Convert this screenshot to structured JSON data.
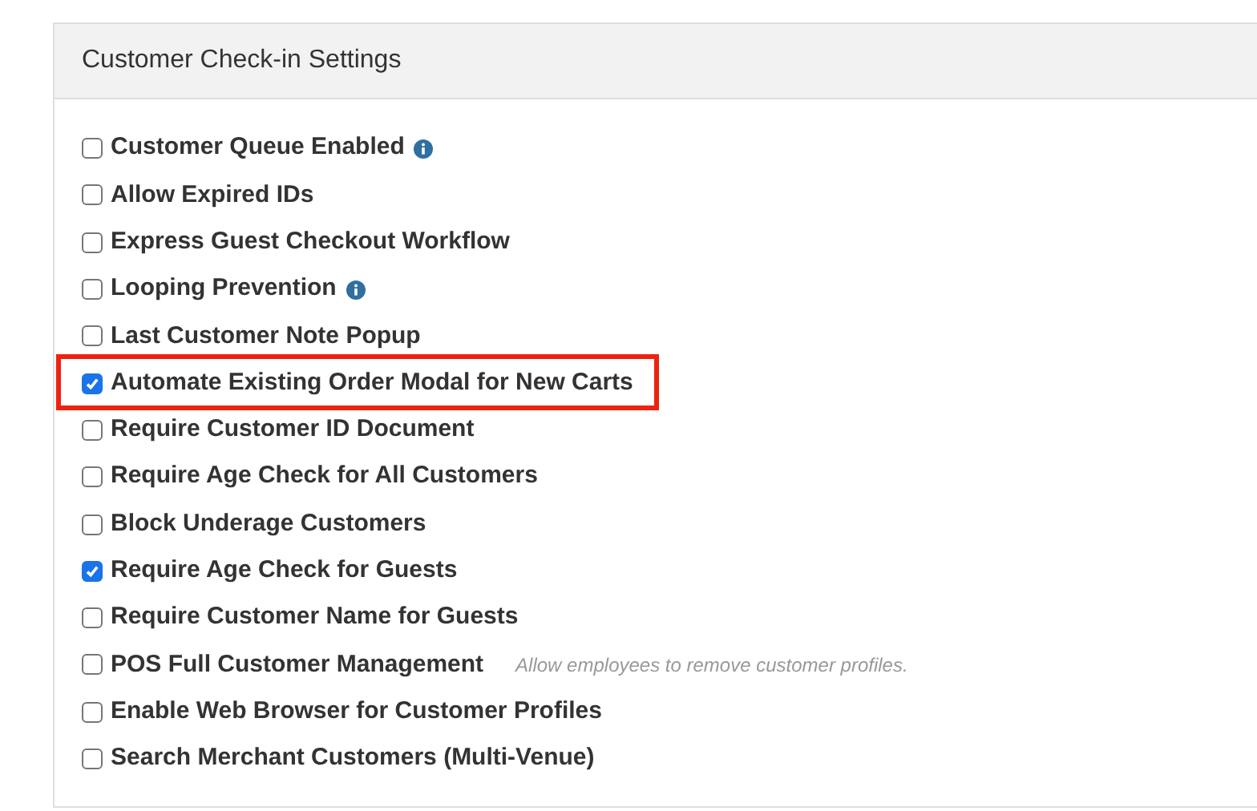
{
  "panel": {
    "title": "Customer Check-in Settings"
  },
  "settings": [
    {
      "label": "Customer Queue Enabled",
      "checked": false,
      "info": true,
      "highlighted": false
    },
    {
      "label": "Allow Expired IDs",
      "checked": false,
      "info": false,
      "highlighted": false
    },
    {
      "label": "Express Guest Checkout Workflow",
      "checked": false,
      "info": false,
      "highlighted": false
    },
    {
      "label": "Looping Prevention",
      "checked": false,
      "info": true,
      "highlighted": false
    },
    {
      "label": "Last Customer Note Popup",
      "checked": false,
      "info": false,
      "highlighted": false
    },
    {
      "label": "Automate Existing Order Modal for New Carts",
      "checked": true,
      "info": false,
      "highlighted": true
    },
    {
      "label": "Require Customer ID Document",
      "checked": false,
      "info": false,
      "highlighted": false
    },
    {
      "label": "Require Age Check for All Customers",
      "checked": false,
      "info": false,
      "highlighted": false
    },
    {
      "label": "Block Underage Customers",
      "checked": false,
      "info": false,
      "highlighted": false
    },
    {
      "label": "Require Age Check for Guests",
      "checked": true,
      "info": false,
      "highlighted": false
    },
    {
      "label": "Require Customer Name for Guests",
      "checked": false,
      "info": false,
      "highlighted": false
    },
    {
      "label": "POS Full Customer Management",
      "checked": false,
      "info": false,
      "highlighted": false,
      "hint": "Allow employees to remove customer profiles."
    },
    {
      "label": "Enable Web Browser for Customer Profiles",
      "checked": false,
      "info": false,
      "highlighted": false
    },
    {
      "label": "Search Merchant Customers (Multi-Venue)",
      "checked": false,
      "info": false,
      "highlighted": false
    }
  ]
}
